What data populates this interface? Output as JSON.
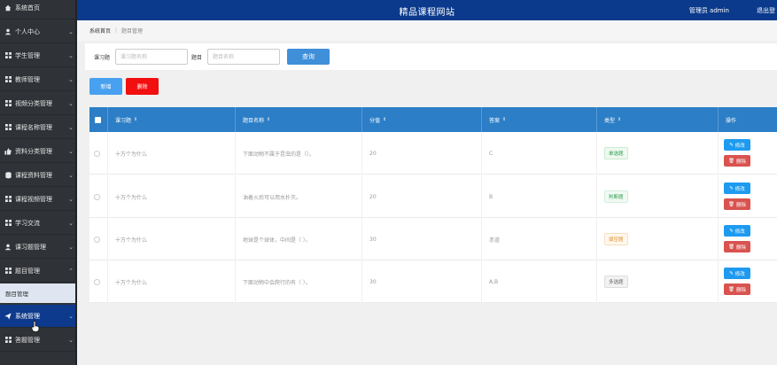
{
  "header": {
    "title": "精品课程网站",
    "user_label": "管理员 admin",
    "logout_label": "退出登"
  },
  "sidebar": {
    "items": [
      {
        "label": "系统首页",
        "icon": "home-icon"
      },
      {
        "label": "个人中心",
        "icon": "user-icon"
      },
      {
        "label": "学生管理",
        "icon": "grid-icon"
      },
      {
        "label": "教师管理",
        "icon": "grid-icon"
      },
      {
        "label": "视频分类管理",
        "icon": "grid-icon"
      },
      {
        "label": "课程名称管理",
        "icon": "grid-icon"
      },
      {
        "label": "资料分类管理",
        "icon": "thumbs-up-icon"
      },
      {
        "label": "课程资料管理",
        "icon": "cylinder-icon"
      },
      {
        "label": "课程视频管理",
        "icon": "grid-icon"
      },
      {
        "label": "学习交流",
        "icon": "grid-icon"
      },
      {
        "label": "课习题管理",
        "icon": "user-icon"
      },
      {
        "label": "题目管理",
        "icon": "grid-icon"
      },
      {
        "label": "系统管理",
        "icon": "send-icon"
      },
      {
        "label": "答题管理",
        "icon": "grid-icon"
      }
    ],
    "sub_item": "题目管理"
  },
  "breadcrumb": {
    "home": "系统首页",
    "current": "题目管理"
  },
  "search": {
    "label_1": "课习题",
    "placeholder_1": "课习题名称",
    "label_2": "题目",
    "placeholder_2": "题目名称",
    "query_label": "查询"
  },
  "actions": {
    "add_label": "新增",
    "delete_label": "删除"
  },
  "table": {
    "columns": [
      "课习题",
      "题目名称",
      "分值",
      "答案",
      "类型",
      "操作"
    ],
    "sort_icon": "⇕",
    "rows": [
      {
        "exercise": "十万个为什么",
        "question": "下面动物不属于昆虫的是（）。",
        "score": "20",
        "answer": "C",
        "type": "单选题"
      },
      {
        "exercise": "十万个为什么",
        "question": "油着火后可以用水扑灭。",
        "score": "20",
        "answer": "B",
        "type": "判断题"
      },
      {
        "exercise": "十万个为什么",
        "question": "地球是个球体，中间是（ ）。",
        "score": "30",
        "answer": "赤道",
        "type": "填空题"
      },
      {
        "exercise": "十万个为什么",
        "question": "下面动物中会爬行的有（ ）。",
        "score": "30",
        "answer": "A,B",
        "type": "多选题"
      }
    ],
    "edit_label": "修改",
    "delete_label": "删除"
  }
}
